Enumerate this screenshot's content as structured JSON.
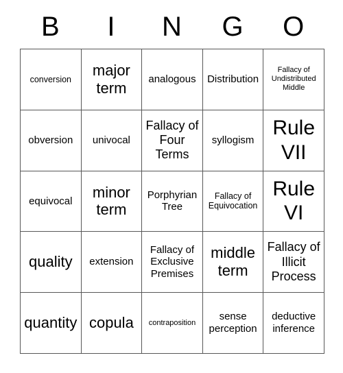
{
  "card": {
    "title": "BINGO",
    "header_letters": [
      "B",
      "I",
      "N",
      "G",
      "O"
    ],
    "columns": 5,
    "rows": 5,
    "border_color": "#575757",
    "text_color": "#000000",
    "background_color": "#ffffff",
    "cells": [
      [
        {
          "text": "conversion",
          "size": "sm"
        },
        {
          "text": "major term",
          "size": "xl"
        },
        {
          "text": "analogous",
          "size": "md"
        },
        {
          "text": "Distribution",
          "size": "md"
        },
        {
          "text": "Fallacy of Undistributed Middle",
          "size": "xs"
        }
      ],
      [
        {
          "text": "obversion",
          "size": "md"
        },
        {
          "text": "univocal",
          "size": "md"
        },
        {
          "text": "Fallacy of Four Terms",
          "size": "lg"
        },
        {
          "text": "syllogism",
          "size": "md"
        },
        {
          "text": "Rule VII",
          "size": "xxl"
        }
      ],
      [
        {
          "text": "equivocal",
          "size": "md"
        },
        {
          "text": "minor term",
          "size": "xl"
        },
        {
          "text": "Porphyrian Tree",
          "size": "md"
        },
        {
          "text": "Fallacy of Equivocation",
          "size": "sm"
        },
        {
          "text": "Rule VI",
          "size": "xxl"
        }
      ],
      [
        {
          "text": "quality",
          "size": "xl"
        },
        {
          "text": "extension",
          "size": "md"
        },
        {
          "text": "Fallacy of Exclusive Premises",
          "size": "md"
        },
        {
          "text": "middle term",
          "size": "xl"
        },
        {
          "text": "Fallacy of Illicit Process",
          "size": "lg"
        }
      ],
      [
        {
          "text": "quantity",
          "size": "xl"
        },
        {
          "text": "copula",
          "size": "xl"
        },
        {
          "text": "contraposition",
          "size": "xs"
        },
        {
          "text": "sense perception",
          "size": "md"
        },
        {
          "text": "deductive inference",
          "size": "md"
        }
      ]
    ]
  }
}
